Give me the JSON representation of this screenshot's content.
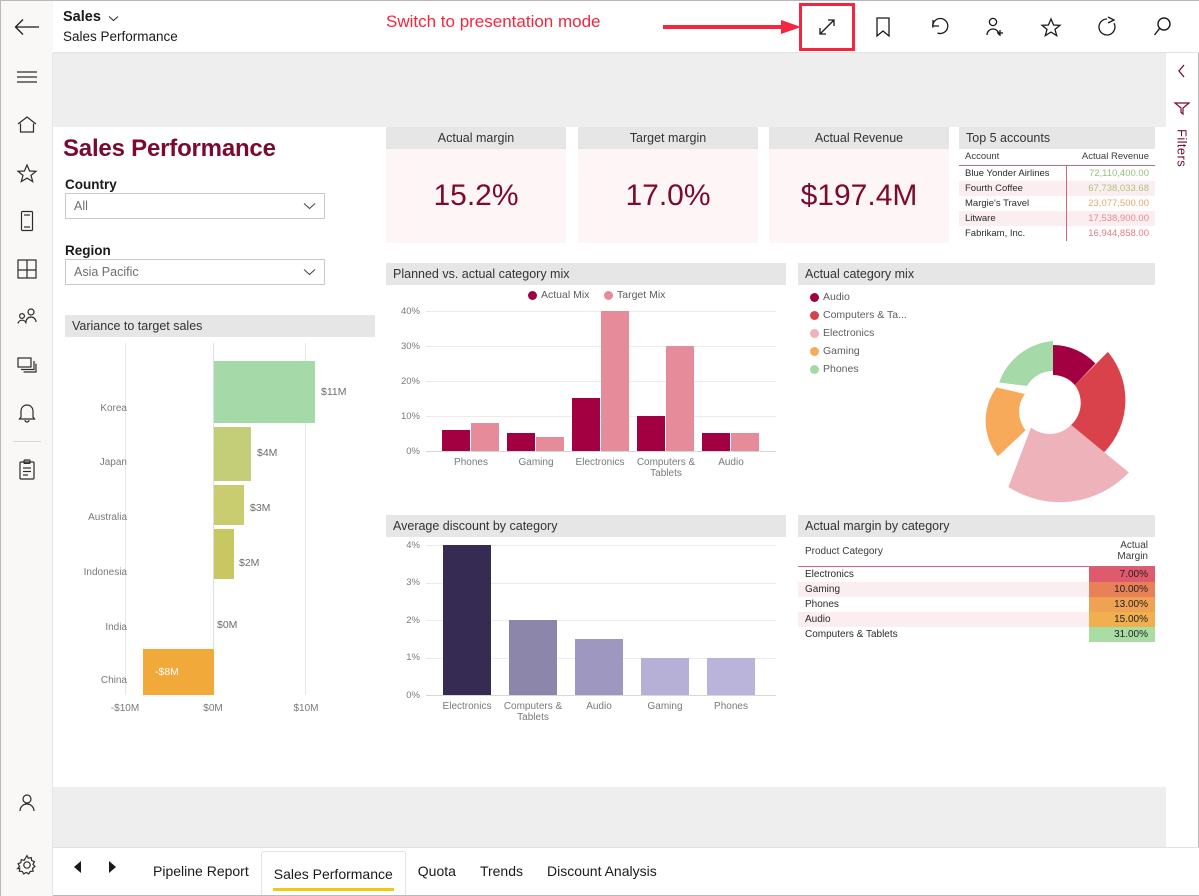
{
  "app": {
    "back_icon": "back-arrow-icon",
    "workspace": "Sales",
    "report_name": "Sales Performance"
  },
  "annotation": {
    "text": "Switch to presentation mode",
    "color": "#f2263c"
  },
  "toolbar": {
    "buttons": [
      {
        "name": "fullscreen-button",
        "icon": "expand-diagonal-icon",
        "highlighted": true
      },
      {
        "name": "bookmark-button",
        "icon": "bookmark-icon",
        "highlighted": false
      },
      {
        "name": "reset-button",
        "icon": "undo-arrow-icon",
        "highlighted": false
      },
      {
        "name": "share-button",
        "icon": "person-add-icon",
        "highlighted": false
      },
      {
        "name": "favorite-button",
        "icon": "star-icon",
        "highlighted": false
      },
      {
        "name": "refresh-button",
        "icon": "refresh-icon",
        "highlighted": false
      },
      {
        "name": "search-button",
        "icon": "search-icon",
        "highlighted": false
      }
    ]
  },
  "sidebar": {
    "items": [
      {
        "name": "menu-button",
        "icon": "hamburger-icon"
      },
      {
        "name": "home-button",
        "icon": "home-icon"
      },
      {
        "name": "favorites-button",
        "icon": "star-icon"
      },
      {
        "name": "recent-button",
        "icon": "phone-icon"
      },
      {
        "name": "apps-button",
        "icon": "grid-icon"
      },
      {
        "name": "shared-button",
        "icon": "people-icon"
      },
      {
        "name": "workspaces-button",
        "icon": "layers-icon"
      },
      {
        "name": "notifications-button",
        "icon": "bell-icon"
      },
      {
        "name": "metrics-button",
        "icon": "clipboard-icon"
      }
    ],
    "footer": [
      {
        "name": "account-button",
        "icon": "person-icon"
      },
      {
        "name": "settings-button",
        "icon": "gear-icon"
      }
    ]
  },
  "filters_panel": {
    "label": "Filters",
    "expand_icon": "chevron-left-icon",
    "filter_icon": "funnel-icon"
  },
  "page": {
    "title": "Sales Performance",
    "slicers": [
      {
        "label": "Country",
        "value": "All",
        "name": "country-slicer"
      },
      {
        "label": "Region",
        "value": "Asia Pacific",
        "name": "region-slicer"
      }
    ]
  },
  "kpis": [
    {
      "title": "Actual margin",
      "value": "15.2%"
    },
    {
      "title": "Target margin",
      "value": "17.0%"
    },
    {
      "title": "Actual Revenue",
      "value": "$197.4M"
    }
  ],
  "top_accounts": {
    "title": "Top 5 accounts",
    "columns": [
      "Account",
      "Actual Revenue"
    ],
    "rows": [
      {
        "account": "Blue Yonder Airlines",
        "revenue": "72,110,400.00",
        "color": "#9bbf7f"
      },
      {
        "account": "Fourth Coffee",
        "revenue": "67,738,033.68",
        "color": "#b0c077"
      },
      {
        "account": "Margie's Travel",
        "revenue": "23,077,500.00",
        "color": "#e8a86a"
      },
      {
        "account": "Litware",
        "revenue": "17,538,900.00",
        "color": "#e98a8a"
      },
      {
        "account": "Fabrikam, Inc.",
        "revenue": "16,944,858.00",
        "color": "#e37b86"
      }
    ]
  },
  "margin_table": {
    "title": "Actual margin by category",
    "columns": [
      "Product Category",
      "Actual Margin"
    ],
    "rows": [
      {
        "category": "Electronics",
        "margin": "7.00%",
        "fill": "#e05a6e"
      },
      {
        "category": "Gaming",
        "margin": "10.00%",
        "fill": "#e88158"
      },
      {
        "category": "Phones",
        "margin": "13.00%",
        "fill": "#efa253"
      },
      {
        "category": "Audio",
        "margin": "15.00%",
        "fill": "#f0b04f"
      },
      {
        "category": "Computers & Tablets",
        "margin": "31.00%",
        "fill": "#a9dda4"
      }
    ]
  },
  "chart_data": [
    {
      "type": "bar",
      "orientation": "horizontal",
      "title": "Variance to target sales",
      "categories": [
        "Korea",
        "Japan",
        "Australia",
        "Indonesia",
        "India",
        "China"
      ],
      "values": [
        11,
        4,
        3,
        2,
        0,
        -8
      ],
      "labels": [
        "$11M",
        "$4M",
        "$3M",
        "$2M",
        "$0M",
        "-$8M"
      ],
      "colors": [
        "#a5d9a7",
        "#c4cd77",
        "#c9cc6f",
        "#c9c761",
        "#ffffff",
        "#f1a93a"
      ],
      "xlabel": "",
      "ylabel": "",
      "xlim": [
        -10,
        10
      ],
      "xticks": [
        "-$10M",
        "$0M",
        "$10M"
      ],
      "grid": true
    },
    {
      "type": "bar",
      "orientation": "vertical",
      "title": "Planned vs. actual category mix",
      "categories": [
        "Phones",
        "Gaming",
        "Electronics",
        "Computers & Tablets",
        "Audio"
      ],
      "series": [
        {
          "name": "Actual Mix",
          "values": [
            6,
            5,
            15,
            10,
            5
          ],
          "color": "#a30041"
        },
        {
          "name": "Target Mix",
          "values": [
            8,
            4,
            40,
            30,
            5
          ],
          "color": "#e58b9a"
        }
      ],
      "ylabel": "",
      "xlabel": "",
      "ylim": [
        0,
        40
      ],
      "yticks": [
        "0%",
        "10%",
        "20%",
        "30%",
        "40%"
      ],
      "legend_position": "top",
      "grid": true
    },
    {
      "type": "pie",
      "variant": "donut-rose",
      "title": "Actual category mix",
      "categories": [
        "Audio",
        "Computers & Ta...",
        "Electronics",
        "Gaming",
        "Phones"
      ],
      "values": [
        13,
        22,
        32,
        12,
        21
      ],
      "radii": [
        1.0,
        1.28,
        1.62,
        0.98,
        1.06
      ],
      "colors": [
        "#a30041",
        "#d9414b",
        "#eeb2bb",
        "#f7ab5a",
        "#a5d9a7"
      ],
      "legend_position": "left"
    },
    {
      "type": "bar",
      "orientation": "vertical",
      "title": "Average discount by category",
      "categories": [
        "Electronics",
        "Computers & Tablets",
        "Audio",
        "Gaming",
        "Phones"
      ],
      "values": [
        4,
        2,
        1.5,
        1,
        1
      ],
      "colors": [
        "#362b52",
        "#8d86ab",
        "#9e97c0",
        "#b6b0d6",
        "#bab4da"
      ],
      "ylabel": "",
      "xlabel": "",
      "ylim": [
        0,
        4
      ],
      "yticks": [
        "0%",
        "1%",
        "2%",
        "3%",
        "4%"
      ],
      "grid": true
    }
  ],
  "page_tabs": {
    "prev_icon": "triangle-left-icon",
    "next_icon": "triangle-right-icon",
    "tabs": [
      {
        "label": "Pipeline Report",
        "active": false
      },
      {
        "label": "Sales Performance",
        "active": true
      },
      {
        "label": "Quota",
        "active": false
      },
      {
        "label": "Trends",
        "active": false
      },
      {
        "label": "Discount Analysis",
        "active": false
      }
    ]
  }
}
